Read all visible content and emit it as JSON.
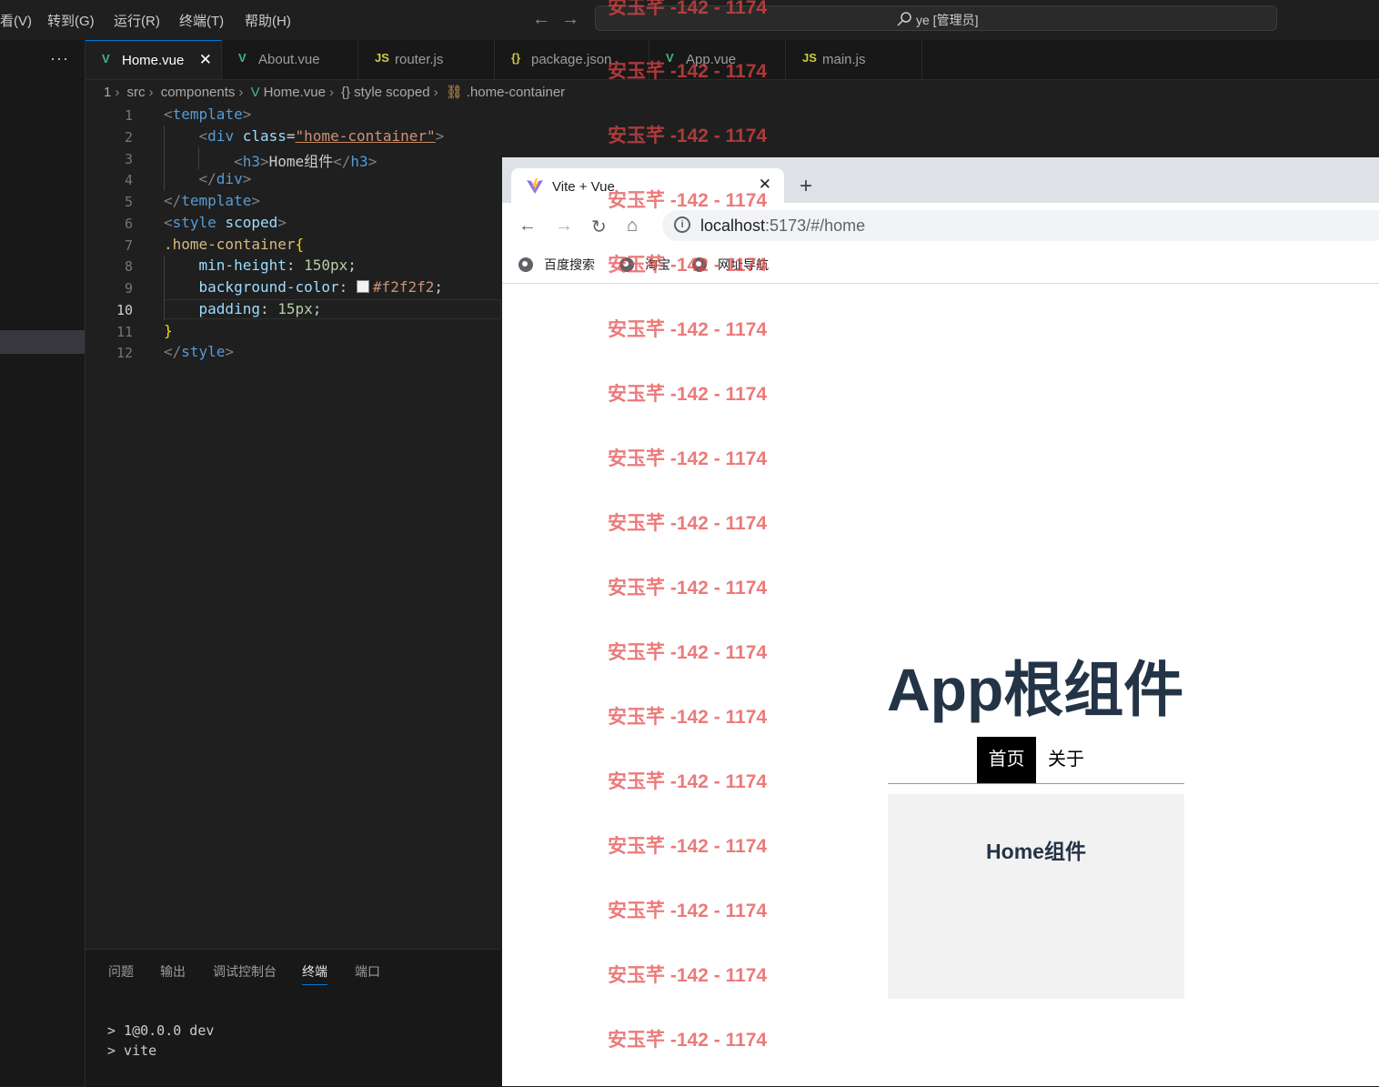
{
  "menubar": {
    "items": [
      "看(V)",
      "转到(G)",
      "运行(R)",
      "终端(T)",
      "帮助(H)"
    ],
    "search": "ye [管理员]"
  },
  "tabs": [
    {
      "icon": "vue-icon",
      "label": "Home.vue",
      "active": true
    },
    {
      "icon": "vue-icon",
      "label": "About.vue"
    },
    {
      "icon": "js-icon",
      "label": "router.js"
    },
    {
      "icon": "json-icon",
      "label": "package.json"
    },
    {
      "icon": "vue-icon",
      "label": "App.vue"
    },
    {
      "icon": "js-icon",
      "label": "main.js"
    }
  ],
  "breadcrumb": [
    "1",
    "src",
    "components",
    "Home.vue",
    "style scoped",
    ".home-container"
  ],
  "editor": {
    "current_line": 10,
    "lines": [
      "<template>",
      "    <div class=\"home-container\">",
      "        <h3>Home组件</h3>",
      "    </div>",
      "</template>",
      "<style scoped>",
      ".home-container{",
      "    min-height: 150px;",
      "    background-color: #f2f2f2;",
      "    padding: 15px;",
      "}",
      "</style>"
    ]
  },
  "panel": {
    "tabs": [
      "问题",
      "输出",
      "调试控制台",
      "终端",
      "端口"
    ],
    "active_tab": "终端",
    "terminal_lines": [
      "> 1@0.0.0 dev",
      "> vite"
    ]
  },
  "browser": {
    "tab_title": "Vite + Vue",
    "url_host": "localhost",
    "url_path": ":5173/#/home",
    "bookmarks": [
      "百度搜索",
      "淘宝",
      "网址导航"
    ],
    "page": {
      "title": "App根组件",
      "nav": [
        "首页",
        "关于"
      ],
      "active_nav": "首页",
      "component_heading": "Home组件",
      "component_bg": "#f2f2f2"
    }
  },
  "watermark": "安玉芊 -142 - 1174",
  "colors": {
    "accent": "#0078d4",
    "vue": "#41b883",
    "watermark": "#e54646",
    "title": "#243447"
  }
}
